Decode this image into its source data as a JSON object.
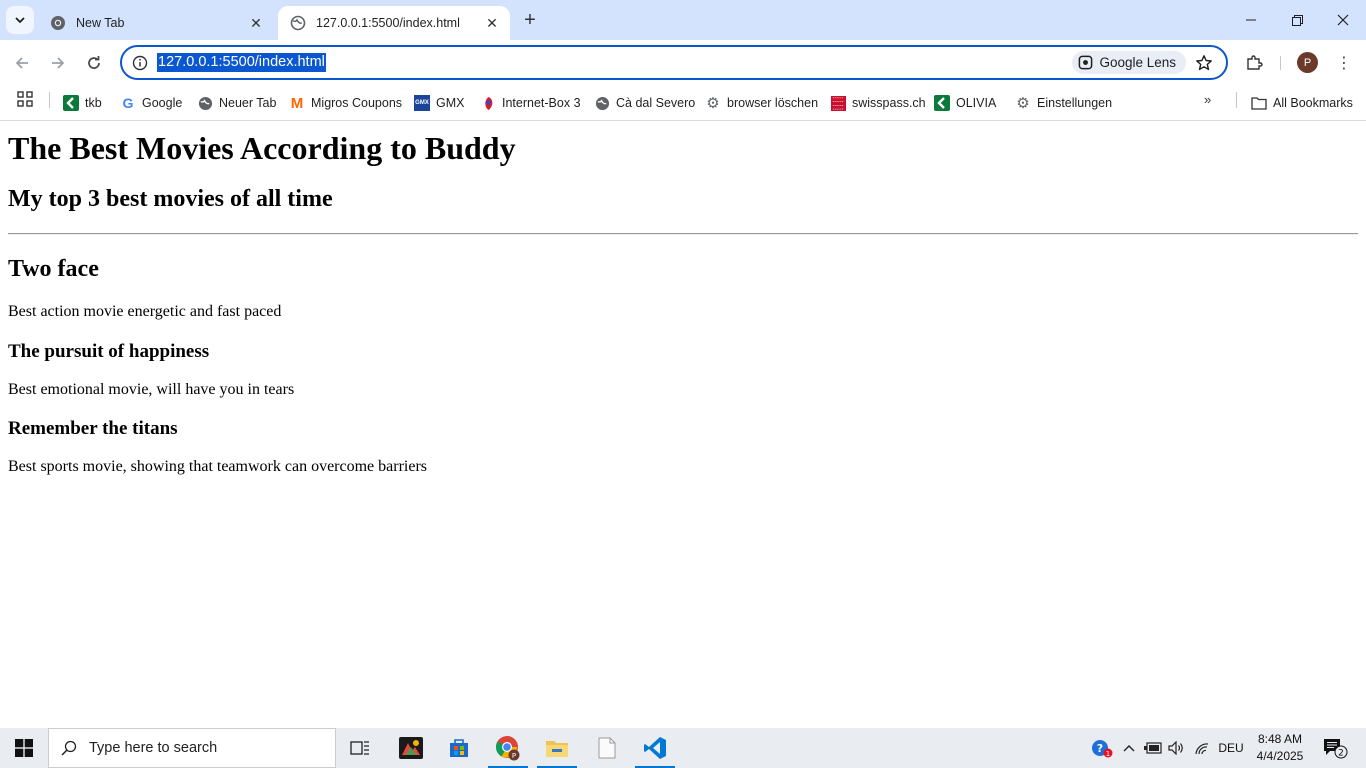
{
  "browser": {
    "tabs": [
      {
        "title": "New Tab",
        "active": false
      },
      {
        "title": "127.0.0.1:5500/index.html",
        "active": true
      }
    ],
    "url": "127.0.0.1:5500/index.html",
    "lens_label": "Google Lens",
    "profile_initial": "P",
    "bookmarks": [
      {
        "label": "tkb",
        "icon": "tkb-icon"
      },
      {
        "label": "Google",
        "icon": "google-icon"
      },
      {
        "label": "Neuer Tab",
        "icon": "globe-icon"
      },
      {
        "label": "Migros Coupons",
        "icon": "migros-icon"
      },
      {
        "label": "GMX",
        "icon": "gmx-icon"
      },
      {
        "label": "Internet-Box 3",
        "icon": "swisscom-icon"
      },
      {
        "label": "Cà dal Severo",
        "icon": "globe-icon"
      },
      {
        "label": "browser löschen",
        "icon": "gear-icon"
      },
      {
        "label": "swisspass.ch",
        "icon": "swisspass-icon"
      },
      {
        "label": "OLIVIA",
        "icon": "olivia-icon"
      },
      {
        "label": "Einstellungen",
        "icon": "gear-icon"
      }
    ],
    "all_bookmarks_label": "All Bookmarks"
  },
  "page": {
    "title": "The Best Movies According to Buddy",
    "subtitle": "My top 3 best movies of all time",
    "movies": [
      {
        "name": "Two face",
        "description": "Best action movie energetic and fast paced"
      },
      {
        "name": "The pursuit of happiness",
        "description": "Best emotional movie, will have you in tears"
      },
      {
        "name": "Remember the titans",
        "description": "Best sports movie, showing that teamwork can overcome barriers"
      }
    ]
  },
  "taskbar": {
    "search_placeholder": "Type here to search",
    "language": "DEU",
    "time": "8:48 AM",
    "date": "4/4/2025",
    "notification_count": "2",
    "help_badge": "1"
  },
  "colors": {
    "tabstrip": "#d3e3fd",
    "accent": "#0b57d0",
    "taskbar": "#e9ecf1"
  }
}
